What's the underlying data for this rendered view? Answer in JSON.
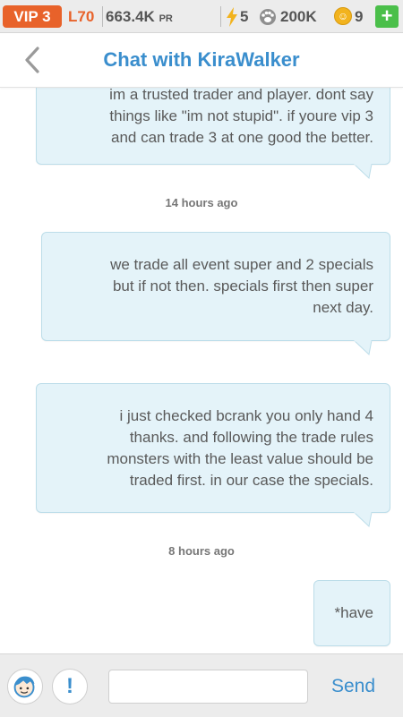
{
  "statusbar": {
    "vip": "VIP 3",
    "level": "L70",
    "pr_value": "663.4K",
    "pr_unit": "PR",
    "energy": "5",
    "food": "200K",
    "coins": "9",
    "plus": "+",
    "icons": [
      "energy-icon",
      "food-icon",
      "coin-icon",
      "plus-icon"
    ]
  },
  "header": {
    "title": "Chat with KiraWalker",
    "back_icon": "chevron-left-icon"
  },
  "messages": [
    {
      "lines": [
        "im a trusted trader and player. dont say",
        "things like \"im not stupid\". if youre vip 3",
        "and can trade 3 at one good the better."
      ]
    },
    {
      "timestamp": "14 hours ago",
      "lines": [
        "we trade all event super and 2 specials",
        "but if not then. specials first then super",
        "next day."
      ]
    },
    {
      "lines": [
        "i just checked bcrank you only hand 4",
        "thanks. and following the trade rules",
        "monsters with the least value should be",
        "traded first. in our case the specials."
      ]
    },
    {
      "timestamp": "8 hours ago",
      "lines": [
        "*have"
      ]
    }
  ],
  "composer": {
    "placeholder": "",
    "value": "",
    "send_label": "Send",
    "warn_label": "!",
    "icons": [
      "avatar-icon",
      "exclamation-icon"
    ]
  },
  "colors": {
    "accent": "#3a8ecd",
    "vip": "#e8622a",
    "bubble": "#e4f3f9",
    "plus": "#4bbf4a"
  }
}
